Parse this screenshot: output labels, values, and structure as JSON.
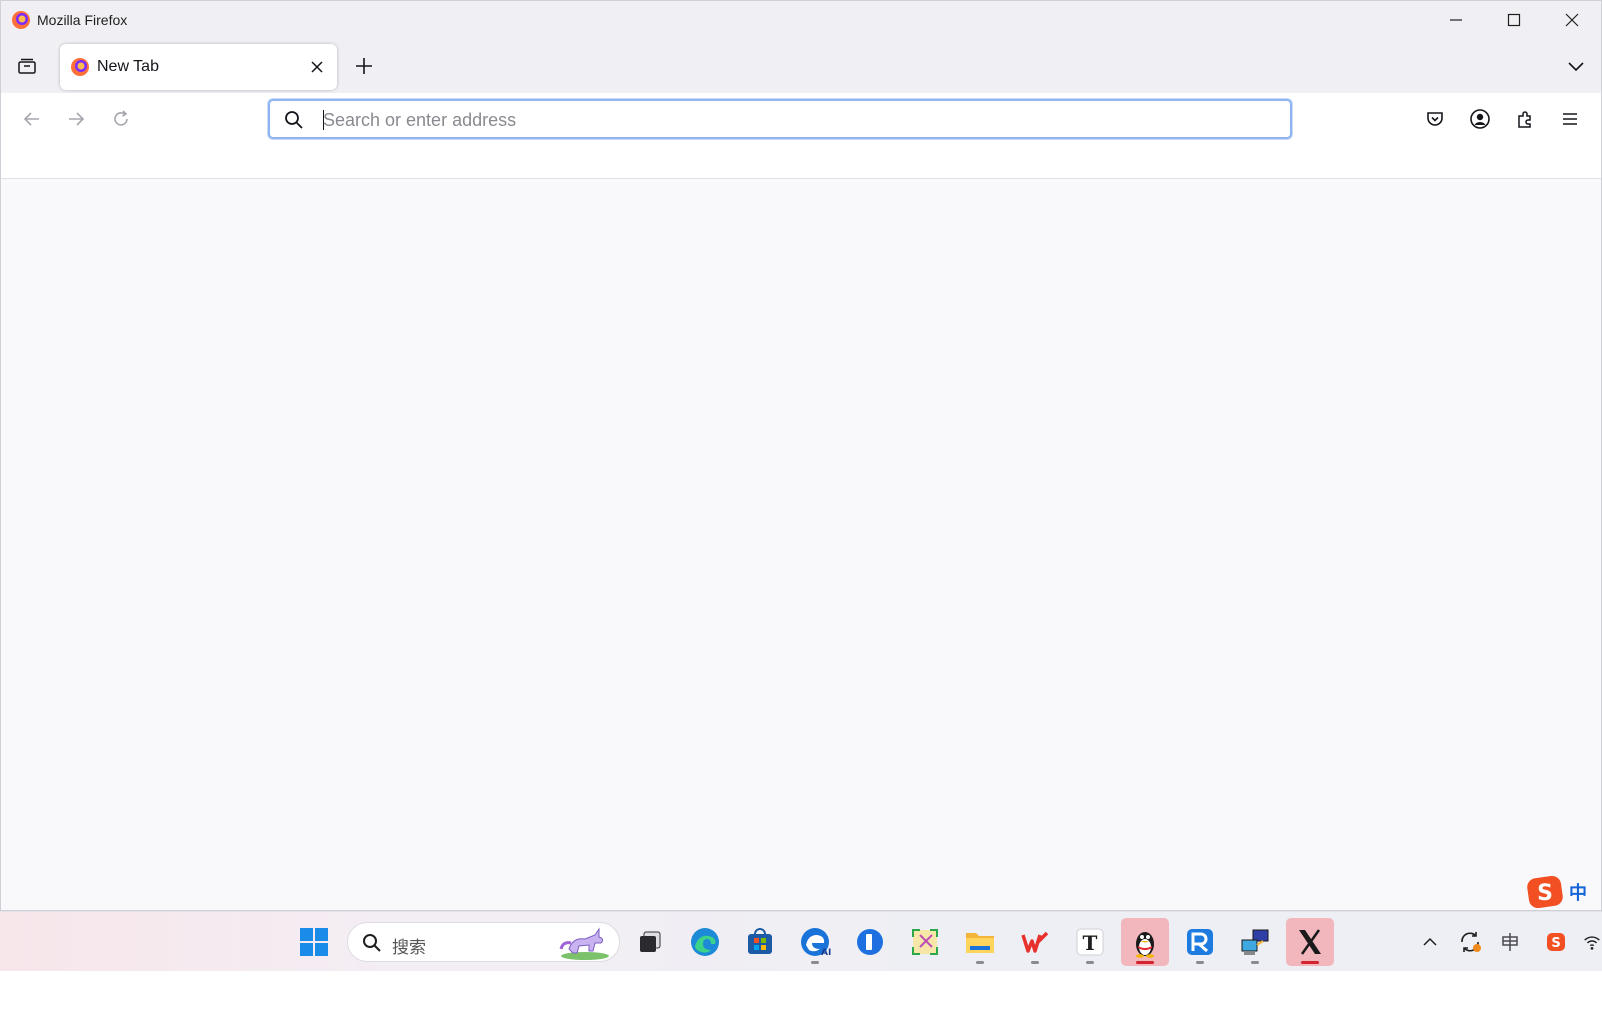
{
  "window": {
    "title": "Mozilla Firefox",
    "controls": [
      "minimize-icon",
      "maximize-icon",
      "close-icon"
    ]
  },
  "tabs": [
    {
      "label": "New Tab",
      "icon": "firefox-icon",
      "active": true
    }
  ],
  "tabstrip": {
    "list_all_tabs_icon": "tab-manager-icon",
    "new_tab_icon": "plus-icon",
    "overflow_icon": "chevron-down-icon"
  },
  "navbar": {
    "back_icon": "arrow-left-icon",
    "forward_icon": "arrow-right-icon",
    "reload_icon": "reload-icon",
    "urlbar": {
      "placeholder": "Search or enter address",
      "value": ""
    },
    "right_icons": [
      "pocket-icon",
      "account-icon",
      "extensions-icon",
      "menu-icon"
    ]
  },
  "ime": {
    "label": "中",
    "icon": "sogou-ime-icon"
  },
  "taskbar": {
    "search": {
      "placeholder": "搜索"
    },
    "apps": [
      {
        "name": "start",
        "icon": "windows-start-icon",
        "running": false
      },
      {
        "name": "task-view",
        "icon": "task-view-icon",
        "running": false
      },
      {
        "name": "edge",
        "icon": "edge-icon",
        "running": false
      },
      {
        "name": "microsoft-store",
        "icon": "store-icon",
        "running": false
      },
      {
        "name": "edge-ai",
        "icon": "edge-ai-icon",
        "running": true
      },
      {
        "name": "app-blue-l",
        "icon": "blue-l-icon",
        "running": false
      },
      {
        "name": "snipping",
        "icon": "snipping-icon",
        "running": false
      },
      {
        "name": "file-explorer",
        "icon": "folder-icon",
        "running": true
      },
      {
        "name": "wps",
        "icon": "wps-icon",
        "running": true
      },
      {
        "name": "typora",
        "icon": "t-icon",
        "running": true
      },
      {
        "name": "qq",
        "icon": "qq-penguin-icon",
        "running": true,
        "active": true
      },
      {
        "name": "app-blue-r",
        "icon": "blue-r-icon",
        "running": true
      },
      {
        "name": "remote-desktop",
        "icon": "network-pc-icon",
        "running": true
      },
      {
        "name": "x-app",
        "icon": "x-icon",
        "running": true,
        "active": true
      }
    ],
    "tray": [
      "chevron-up-icon",
      "sync-icon",
      "keyboard-layout-icon",
      "sogou-tray-icon",
      "wifi-icon"
    ]
  },
  "colors": {
    "titlebar": "#f0f0f4",
    "urlbar_focus": "#8fb4f0",
    "active_taskbar_item": "#f1b7bd",
    "active_indicator": "#d1242f"
  }
}
